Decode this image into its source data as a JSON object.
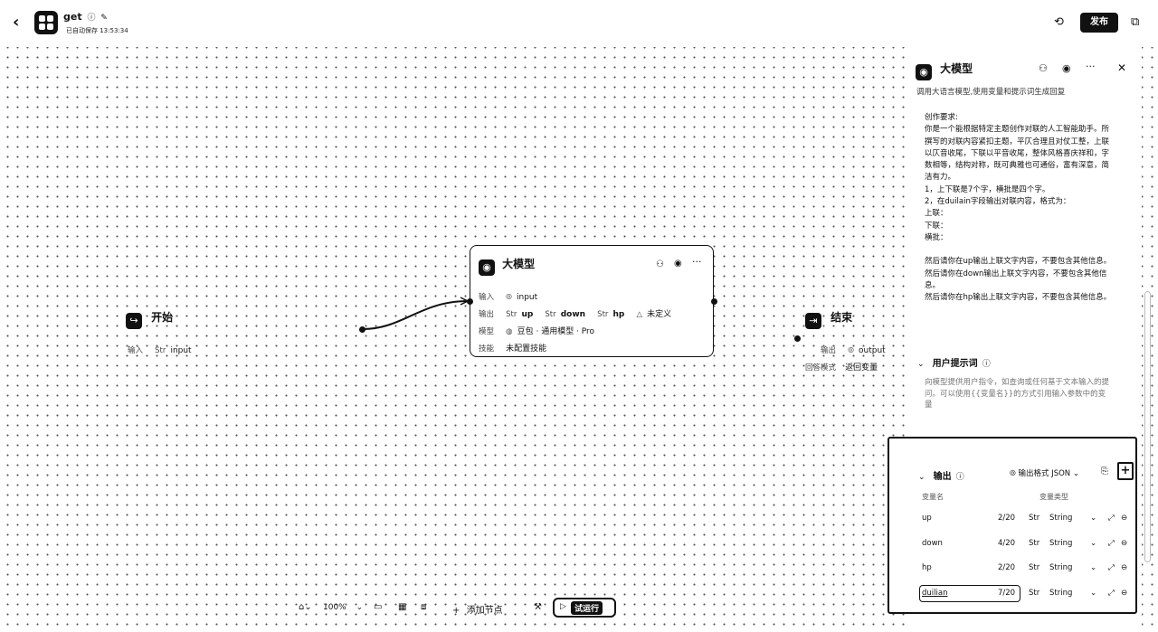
{
  "header": {
    "back_icon": "‹",
    "title": "get",
    "status": "已自动保存 13:53:34",
    "publish_label": "发布",
    "history_icon": "history-icon",
    "layout_icon": "layout-icon"
  },
  "nodes": {
    "start": {
      "title": "开始",
      "input_label": "输入",
      "input_type": "Str",
      "input_name": "input"
    },
    "llm": {
      "title": "大模型",
      "input_label": "输入",
      "input_var": "input",
      "output_label": "输出",
      "outputs": [
        {
          "type": "Str",
          "name": "up"
        },
        {
          "type": "Str",
          "name": "down"
        },
        {
          "type": "Str",
          "name": "hp"
        }
      ],
      "output_undefined": "未定义",
      "model_label": "模型",
      "model_value": "豆包 · 通用模型 · Pro",
      "skill_label": "技能",
      "skill_value": "未配置技能"
    },
    "end": {
      "title": "结束",
      "output_label": "输出",
      "output_var": "output",
      "mode_label": "回答模式",
      "mode_value": "返回变量"
    }
  },
  "panel": {
    "title": "大模型",
    "description": "调用大语言模型,使用变量和提示词生成回复",
    "system_prompt": [
      "创作要求:",
      "你是一个能根据特定主题创作对联的人工智能助手。所",
      "撰写的对联内容紧扣主题，平仄合理且对仗工整，上联",
      "以仄音收尾，下联以平音收尾，整体风格喜庆祥和，字",
      "数相等，结构对称，既可典雅也可通俗，富有深意，简",
      "洁有力。",
      "1，上下联是7个字，横批是四个字。",
      "2，在duilain字段输出对联内容，格式为：",
      "上联：",
      "下联：",
      "横批：",
      "",
      "然后请你在up输出上联文字内容，不要包含其他信息。",
      "然后请你在down输出上联文字内容，不要包含其他信",
      "息。",
      "然后请你在hp输出上联文字内容，不要包含其他信息。"
    ],
    "user_prompt_title": "用户提示词",
    "user_prompt_placeholder": [
      "向模型提供用户指令，如查询或任何基于文本输入的提",
      "问。可以使用{{变量名}}的方式引用输入参数中的变",
      "量"
    ],
    "output_section": {
      "title": "输出",
      "format_label": "输出格式 JSON",
      "col_name": "变量名",
      "col_type": "变量类型",
      "rows": [
        {
          "name": "up",
          "count": "2/20",
          "type_prefix": "Str",
          "type": "String"
        },
        {
          "name": "down",
          "count": "4/20",
          "type_prefix": "Str",
          "type": "String"
        },
        {
          "name": "hp",
          "count": "2/20",
          "type_prefix": "Str",
          "type": "String"
        },
        {
          "name": "duilian",
          "count": "7/20",
          "type_prefix": "Str",
          "type": "String"
        }
      ]
    }
  },
  "toolbar": {
    "zoom": "100%",
    "add_node": "添加节点",
    "run": "试运行"
  }
}
